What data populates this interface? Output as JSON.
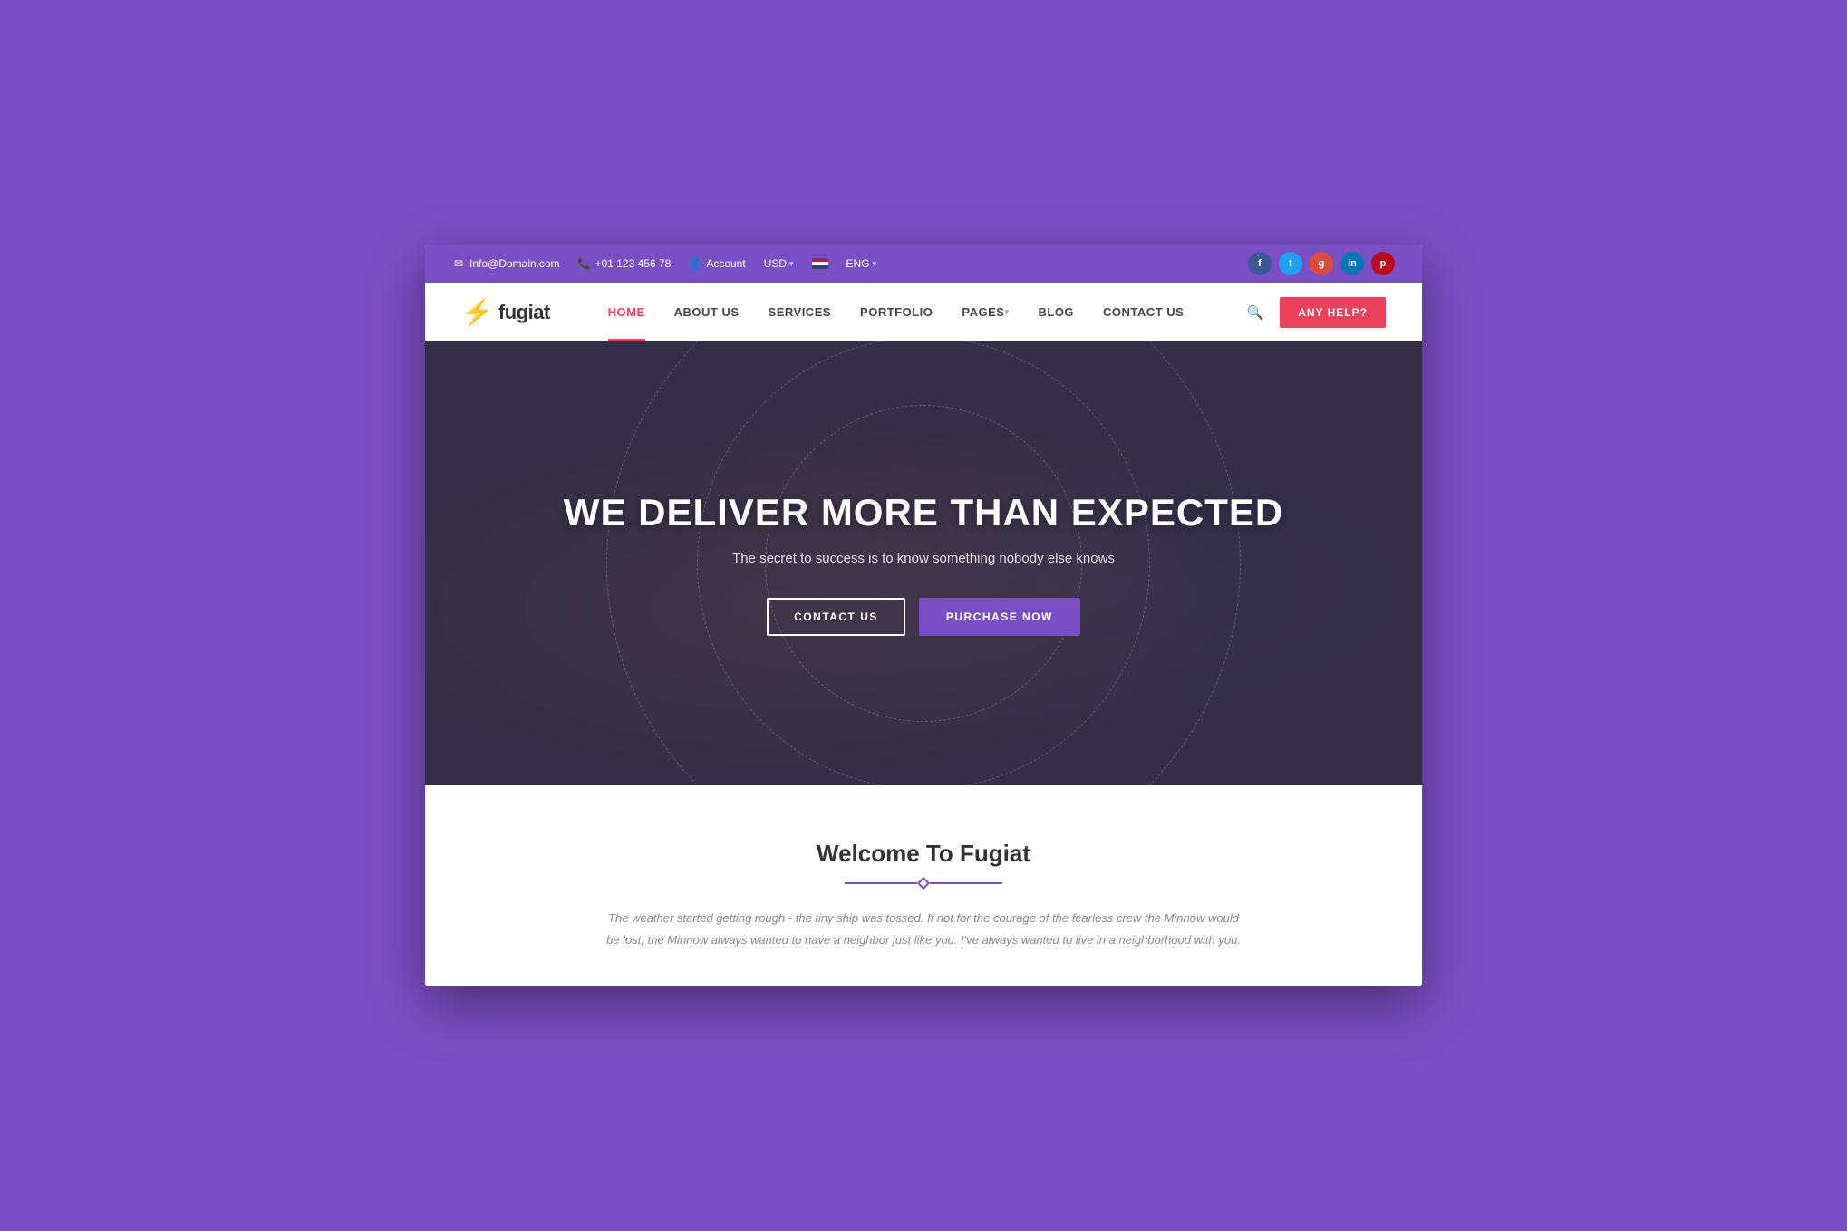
{
  "topbar": {
    "email_icon": "✉",
    "email": "Info@Domain.com",
    "phone_icon": "📞",
    "phone": "+01 123 456 78",
    "account_icon": "👤",
    "account_label": "Account",
    "currency": "USD",
    "language": "ENG"
  },
  "social": [
    {
      "name": "facebook",
      "label": "f",
      "class": "social-fb"
    },
    {
      "name": "twitter",
      "label": "t",
      "class": "social-tw"
    },
    {
      "name": "google-plus",
      "label": "g+",
      "class": "social-gp"
    },
    {
      "name": "linkedin",
      "label": "in",
      "class": "social-li"
    },
    {
      "name": "pinterest",
      "label": "p",
      "class": "social-pi"
    }
  ],
  "navbar": {
    "logo_text": "fugiat",
    "any_help_label": "ANY HELP?",
    "nav_items": [
      {
        "label": "HOME",
        "active": true,
        "has_dropdown": false
      },
      {
        "label": "ABOUT US",
        "active": false,
        "has_dropdown": false
      },
      {
        "label": "SERVICES",
        "active": false,
        "has_dropdown": false
      },
      {
        "label": "PORTFOLIO",
        "active": false,
        "has_dropdown": false
      },
      {
        "label": "PAGES",
        "active": false,
        "has_dropdown": true
      },
      {
        "label": "BLOG",
        "active": false,
        "has_dropdown": false
      },
      {
        "label": "CONTACT US",
        "active": false,
        "has_dropdown": false
      }
    ]
  },
  "hero": {
    "title": "WE DELIVER MORE THAN EXPECTED",
    "subtitle": "The secret to success is to know something nobody else knows",
    "btn_contact": "CONTACT US",
    "btn_purchase": "PURCHASE NOW"
  },
  "welcome": {
    "title": "Welcome To Fugiat",
    "body": "The weather started getting rough - the tiny ship was tossed. If not for the courage of the fearless crew the Minnow would be lost, the Minnow always wanted to have a neighbor just like you. I've always wanted to live in a neighborhood with you."
  }
}
